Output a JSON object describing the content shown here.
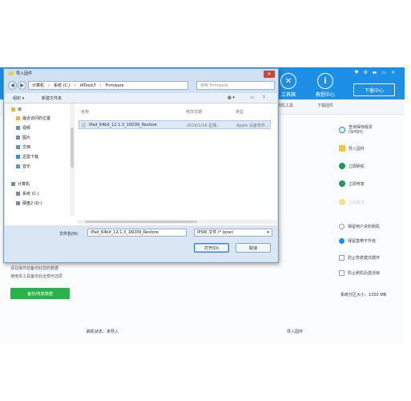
{
  "app": {
    "top_icons": "♥ ⚙ ▬ ▭ ✕",
    "toolbox_label": "工具箱",
    "tutorial_label": "教程中心",
    "download_label": "下载中心",
    "sub_tabs": [
      "刷机工具",
      "下载固件"
    ],
    "right_panel": {
      "query": "查询保存版本",
      "shsh": "(SHSH)",
      "import_firmware": "导入固件",
      "flash_now": "立即刷机",
      "repair": "立即修复",
      "activate": "立即激活",
      "opt_keep_data": "保留用户资料刷机",
      "opt_fix_restore": "保留基带不升级",
      "opt_anti_recovery": "防止恢复模式循环",
      "opt_full_wipe": "防止刷机后激活锁",
      "partition": "系统分区大小：1350 MB"
    },
    "left_notes": [
      "请在操作前备份好您的数据",
      "使用本工具备份后全部可还原"
    ],
    "backup_button": "备份/恢复数据",
    "status_left": "刷机状态：未导入",
    "status_right": "导入固件"
  },
  "dialog": {
    "title": "导入固件",
    "close": "✕",
    "path": [
      "计算机",
      "系统 (C:)",
      "i4Tools7",
      "Firmware"
    ],
    "search_placeholder": "搜索 Firmware",
    "toolbar": {
      "organize": "组织 ▾",
      "new_folder": "新建文件夹"
    },
    "sidebar": [
      {
        "label": "库",
        "color": "#e8b84a"
      },
      {
        "label": "最近访问的位置",
        "color": "#e8b84a"
      },
      {
        "label": "视频",
        "color": "#6d8fb8"
      },
      {
        "label": "图片",
        "color": "#6d8fb8"
      },
      {
        "label": "文档",
        "color": "#6d8fb8"
      },
      {
        "label": "迅雷下载",
        "color": "#3a8de0"
      },
      {
        "label": "音乐",
        "color": "#6d8fb8"
      },
      {
        "label": "计算机",
        "color": "#7a8aa0"
      },
      {
        "label": "系统 (C:)",
        "color": "#7a8aa0"
      },
      {
        "label": "硬盘2 (D:)",
        "color": "#7a8aa0"
      }
    ],
    "columns": {
      "name": "名称",
      "date": "修改日期",
      "type": "类型"
    },
    "file": {
      "name": "iPad_64bit_12.1.3_16D39_Restore",
      "date": "2019/1/16 星期...",
      "type": "Apple 设备软件..."
    },
    "filename_label": "文件名(N):",
    "filename_value": "iPad_64bit_12.1.3_16D39_Restore",
    "filter": "IPSW 文件 (*.ipsw)",
    "open_button": "打开(O)",
    "cancel_button": "取消"
  }
}
